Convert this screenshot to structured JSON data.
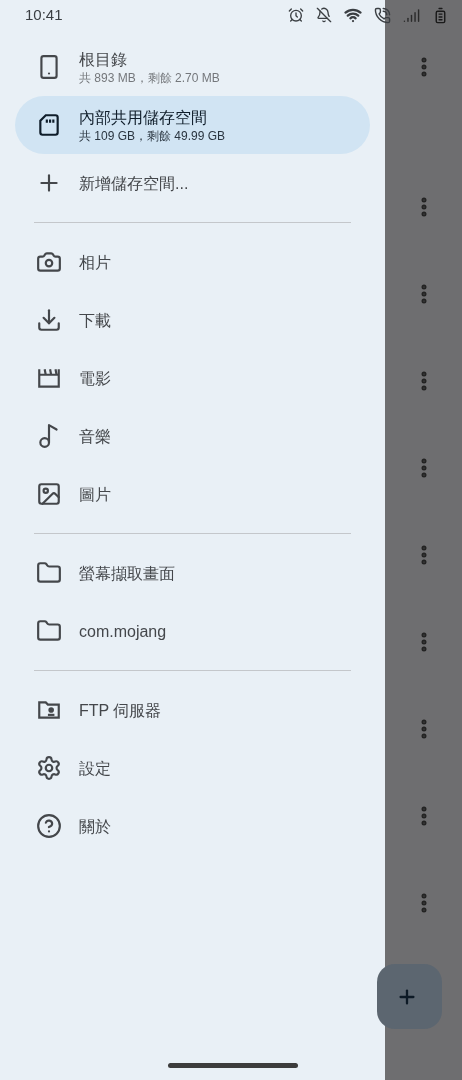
{
  "status_bar": {
    "time": "10:41"
  },
  "drawer": {
    "sections": [
      {
        "items": [
          {
            "kind": "phone",
            "label": "根目錄",
            "detail": "共 893 MB，剩餘 2.70 MB",
            "selected": false
          },
          {
            "kind": "sdcard",
            "label": "內部共用儲存空間",
            "detail": "共 109 GB，剩餘 49.99 GB",
            "selected": true
          },
          {
            "kind": "add",
            "label": "新增儲存空間...",
            "selected": false
          }
        ]
      },
      {
        "items": [
          {
            "kind": "camera",
            "label": "相片",
            "selected": false
          },
          {
            "kind": "download",
            "label": "下載",
            "selected": false
          },
          {
            "kind": "movie",
            "label": "電影",
            "selected": false
          },
          {
            "kind": "music",
            "label": "音樂",
            "selected": false
          },
          {
            "kind": "image",
            "label": "圖片",
            "selected": false
          }
        ]
      },
      {
        "items": [
          {
            "kind": "folder",
            "label": "螢幕擷取畫面",
            "selected": false
          },
          {
            "kind": "folder",
            "label": "com.mojang",
            "selected": false
          }
        ]
      },
      {
        "items": [
          {
            "kind": "ftp",
            "label": "FTP 伺服器",
            "selected": false
          },
          {
            "kind": "settings",
            "label": "設定",
            "selected": false
          },
          {
            "kind": "help",
            "label": "關於",
            "selected": false
          }
        ]
      }
    ]
  }
}
